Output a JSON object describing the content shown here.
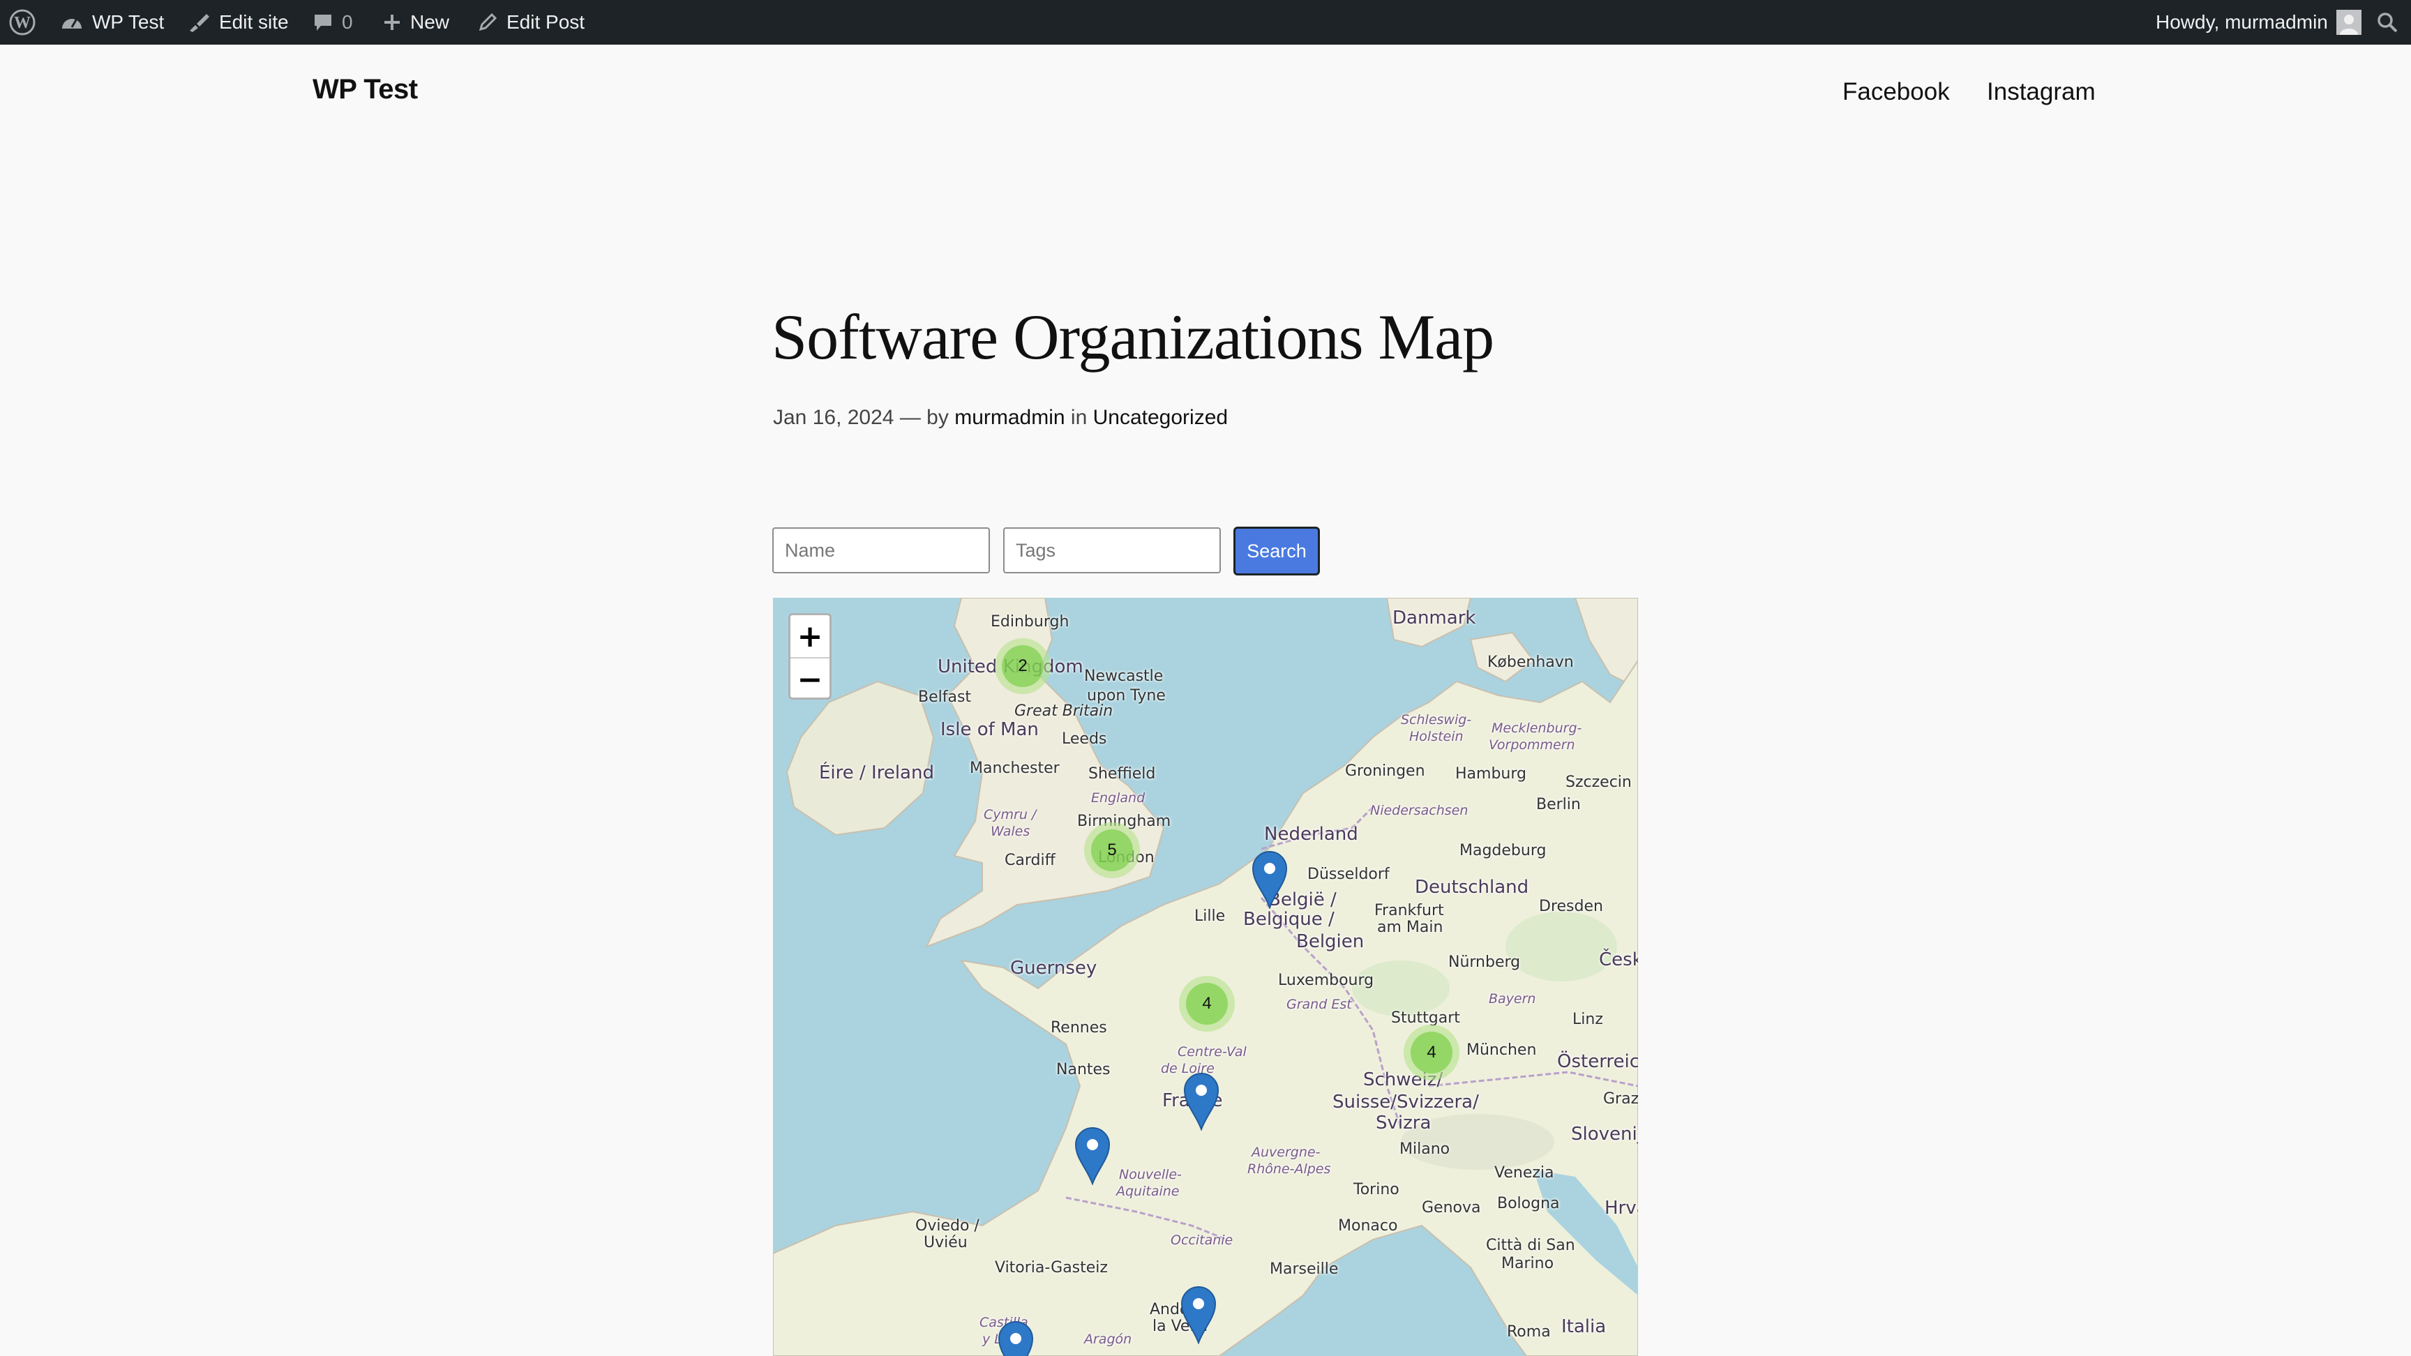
{
  "admin_bar": {
    "site_name": "WP Test",
    "edit_site": "Edit site",
    "comments_count": "0",
    "new_label": "New",
    "edit_post": "Edit Post",
    "greeting": "Howdy, murmadmin",
    "icons": [
      "wordpress-logo-icon",
      "dashboard-icon",
      "brush-icon",
      "comment-icon",
      "plus-icon",
      "pencil-icon",
      "avatar-icon",
      "search-icon"
    ]
  },
  "header": {
    "site_title": "WP Test",
    "nav": [
      "Facebook",
      "Instagram"
    ]
  },
  "post": {
    "title": "Software Organizations Map",
    "date": "Jan 16, 2024",
    "by": "— by",
    "author": "murmadmin",
    "in": "in",
    "category": "Uncategorized"
  },
  "search_form": {
    "name_placeholder": "Name",
    "tags_placeholder": "Tags",
    "button": "Search"
  },
  "map": {
    "zoom_in": "+",
    "zoom_out": "−",
    "clusters": [
      "2",
      "5",
      "4",
      "4"
    ],
    "labels": {
      "edinburgh": "Edinburgh",
      "united_kingdom": "United Kingdom",
      "newcastle": "Newcastle",
      "upon_tyne": "upon Tyne",
      "belfast": "Belfast",
      "great_britain": "Great Britain",
      "isle_of_man": "Isle of Man",
      "leeds": "Leeds",
      "eire": "Éire / Ireland",
      "manchester": "Manchester",
      "sheffield": "Sheffield",
      "england": "England",
      "birmingham": "Birmingham",
      "cymru": "Cymru /",
      "wales": "Wales",
      "cardiff": "Cardiff",
      "london": "London",
      "danmark": "Danmark",
      "kobenhavn": "København",
      "schleswig": "Schleswig-",
      "holstein": "Holstein",
      "mecklenburg": "Mecklenburg-",
      "vorpommern": "Vorpommern",
      "groningen": "Groningen",
      "hamburg": "Hamburg",
      "szczecin": "Szczecin",
      "berlin": "Berlin",
      "niedersachsen": "Niedersachsen",
      "nederland": "Nederland",
      "magdeburg": "Magdeburg",
      "dusseldorf": "Düsseldorf",
      "deutschland": "Deutschland",
      "belgie": "België /",
      "belgique": "Belgique /",
      "belgien": "Belgien",
      "lille": "Lille",
      "frankfurt": "Frankfurt",
      "am_main": "am Main",
      "dresden": "Dresden",
      "luxembourg": "Luxembourg",
      "guernsey": "Guernsey",
      "nurnberg": "Nürnberg",
      "cesko": "Česk",
      "grand_est": "Grand Est",
      "bayern": "Bayern",
      "rennes": "Rennes",
      "stuttgart": "Stuttgart",
      "linz": "Linz",
      "munchen": "München",
      "osterreich": "Österreich",
      "nantes": "Nantes",
      "centre_val": "Centre-Val",
      "de_loire": "de Loire",
      "schweiz": "Schweiz/",
      "suisse": "Suisse/Svizzera/",
      "svizra": "Svizra",
      "france": "France",
      "graz": "Graz",
      "slovenija": "Slovenija",
      "milano": "Milano",
      "auvergne": "Auvergne-",
      "rhone_alpes": "Rhône-Alpes",
      "nouvelle": "Nouvelle-",
      "aquitaine": "Aquitaine",
      "torino": "Torino",
      "venezia": "Venezia",
      "bologna": "Bologna",
      "hrvatsk": "Hrvatsk",
      "genova": "Genova",
      "oviedo": "Oviedo /",
      "uvieu": "Uviéu",
      "monaco": "Monaco",
      "citta": "Città di San",
      "marino": "Marino",
      "occitanie": "Occitanie",
      "vitoria": "Vitoria-Gasteiz",
      "marseille": "Marseille",
      "castilla": "Castilla",
      "y_leon": "y León",
      "andorra": "Andorra",
      "la_vella": "la Vella",
      "aragon": "Aragón",
      "italia": "Italia",
      "roma": "Roma"
    }
  }
}
